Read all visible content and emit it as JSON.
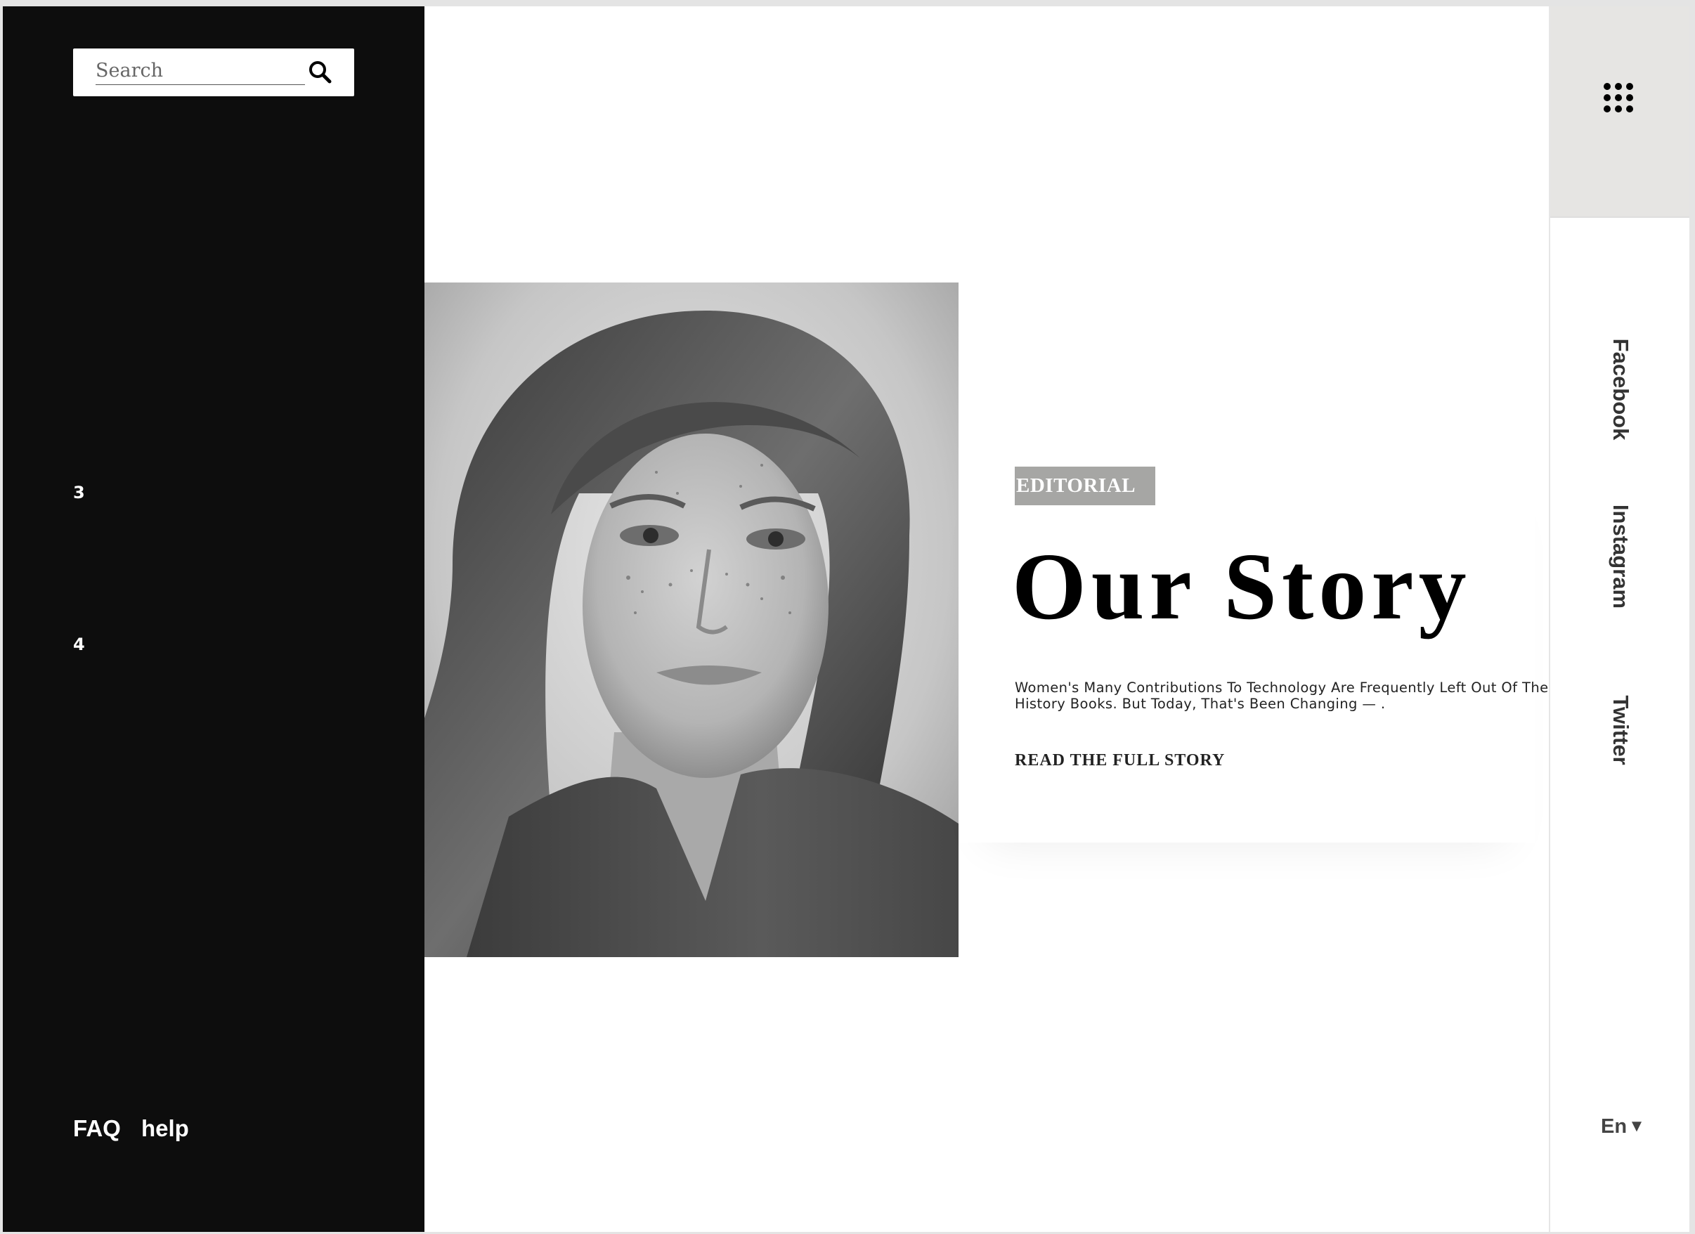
{
  "sidebar": {
    "search": {
      "placeholder": "Search"
    },
    "numbers": [
      "3",
      "4"
    ],
    "footer_links": [
      "FAQ",
      "help"
    ]
  },
  "hero": {
    "badge": "EDITORIAL",
    "title": "Our Story",
    "description": "Women's Many Contributions To Technology Are Frequently Left Out Of The History Books. But Today, That's Been Changing — .",
    "cta": "READ THE FULL STORY"
  },
  "right_rail": {
    "social_links": [
      "Facebook",
      "Instagram",
      "Twitter"
    ],
    "language": "En"
  },
  "icons": {
    "search": "search-icon",
    "menu": "grid-dots-icon",
    "language_dropdown": "caret-down-icon"
  },
  "colors": {
    "sidebar_bg": "#0d0d0d",
    "badge_bg": "#a6a6a4",
    "rail_menu_bg": "#e6e5e3"
  }
}
